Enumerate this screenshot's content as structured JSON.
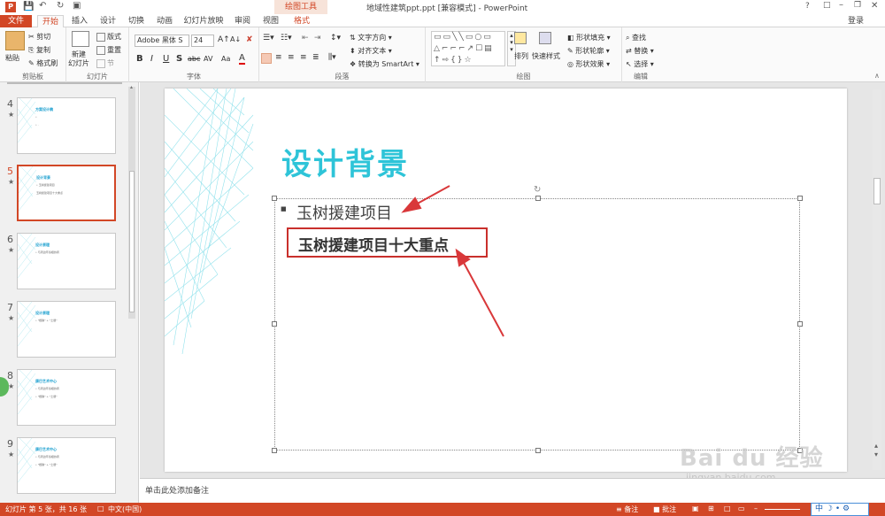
{
  "title_bar": {
    "document_title": "地域性建筑ppt.ppt [兼容模式] - PowerPoint",
    "contextual_tab_group": "绘图工具",
    "window_controls": [
      "?",
      "□",
      "–",
      "❐",
      "✕"
    ]
  },
  "tabs": [
    {
      "label": "文件",
      "active": false,
      "file": true
    },
    {
      "label": "开始",
      "active": true
    },
    {
      "label": "插入"
    },
    {
      "label": "设计"
    },
    {
      "label": "切换"
    },
    {
      "label": "动画"
    },
    {
      "label": "幻灯片放映"
    },
    {
      "label": "审阅"
    },
    {
      "label": "视图"
    },
    {
      "label": "格式"
    }
  ],
  "account": {
    "login": "登录"
  },
  "ribbon": {
    "clipboard": {
      "paste": "粘贴",
      "cut": "剪切",
      "copy": "复制",
      "format_painter": "格式刷",
      "group": "剪贴板"
    },
    "slides": {
      "new_slide": "新建\n幻灯片",
      "layout": "版式",
      "reset": "重置",
      "section": "节",
      "group": "幻灯片"
    },
    "font": {
      "font_name": "Adobe 黑体 S",
      "font_size": "24",
      "bold": "B",
      "italic": "I",
      "underline": "U",
      "shadow": "S",
      "strike": "abc",
      "spacing": "AV",
      "case": "Aa",
      "color": "A",
      "group": "字体"
    },
    "paragraph": {
      "text_direction": "文字方向",
      "align_text": "对齐文本",
      "smartart": "转换为 SmartArt",
      "group": "段落"
    },
    "drawing": {
      "arrange": "排列",
      "quick_styles": "快速样式",
      "shape_fill": "形状填充",
      "shape_outline": "形状轮廓",
      "shape_effects": "形状效果",
      "group": "绘图"
    },
    "editing": {
      "find": "查找",
      "replace": "替换",
      "select": "选择",
      "group": "编辑"
    }
  },
  "thumbnails": [
    {
      "num": "4",
      "title": "方案设计稿",
      "lines": [
        "•",
        "•   ·"
      ],
      "selected": false
    },
    {
      "num": "5",
      "title": "设计背景",
      "lines": [
        "• 玉树援建项目",
        "  玉树援建项目十大重点"
      ],
      "selected": true
    },
    {
      "num": "6",
      "title": "设计原理",
      "lines": [
        "• 与周边环境相协调"
      ],
      "selected": false
    },
    {
      "num": "7",
      "title": "设计原理",
      "lines": [
        "• \"根脉\" + \"土壤\""
      ],
      "selected": false
    },
    {
      "num": "8",
      "title": "康巴艺术中心",
      "lines": [
        "• 与周边环境相协调",
        "• \"根脉\" + \"土壤\""
      ],
      "selected": false
    },
    {
      "num": "9",
      "title": "康巴艺术中心",
      "lines": [
        "• 与周边环境相协调",
        "• \"根脉\" + \"土壤\""
      ],
      "selected": false
    }
  ],
  "slide": {
    "title": "设计背景",
    "bullet1": "玉树援建项目",
    "highlight": "玉树援建项目十大重点"
  },
  "notes": {
    "placeholder": "单击此处添加备注"
  },
  "status_bar": {
    "slide_info": "幻灯片 第 5 张，共 16 张",
    "language": "中文(中国)",
    "notes_btn": "备注",
    "comments_btn": "批注",
    "ime": "中"
  },
  "watermark": {
    "brand": "Bai du 经验",
    "url": "jingyan.baidu.com"
  },
  "colors": {
    "accent": "#d24726",
    "slide_title": "#2ec4d8",
    "annotation": "#d9383a"
  }
}
